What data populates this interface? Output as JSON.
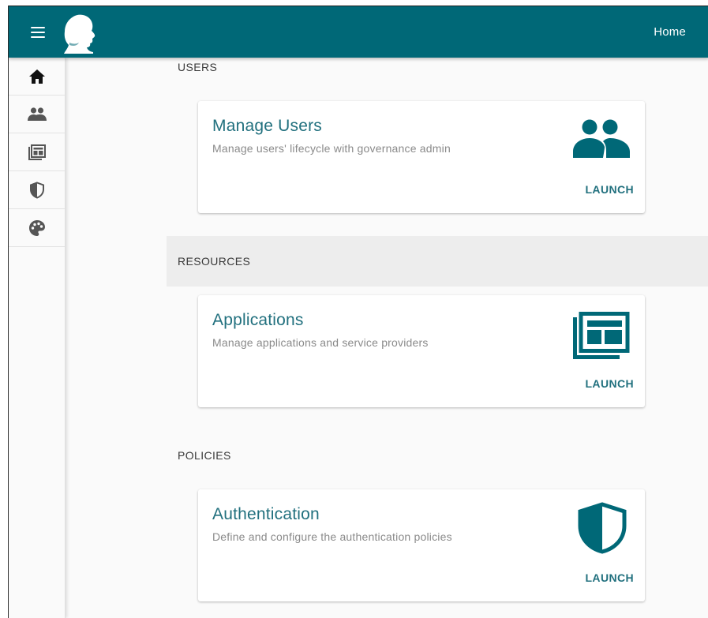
{
  "header": {
    "home_label": "Home",
    "brand_color": "#006877"
  },
  "sidebar": {
    "items": [
      {
        "icon": "home-icon",
        "active": true
      },
      {
        "icon": "users-icon"
      },
      {
        "icon": "applications-icon"
      },
      {
        "icon": "shield-icon"
      },
      {
        "icon": "palette-icon"
      }
    ]
  },
  "sections": [
    {
      "title": "USERS",
      "card": {
        "title": "Manage Users",
        "description": "Manage users' lifecycle with governance admin",
        "icon": "users-icon",
        "action": "LAUNCH"
      }
    },
    {
      "title": "RESOURCES",
      "card": {
        "title": "Applications",
        "description": "Manage applications and service providers",
        "icon": "applications-icon",
        "action": "LAUNCH"
      }
    },
    {
      "title": "POLICIES",
      "card": {
        "title": "Authentication",
        "description": "Define and configure the authentication policies",
        "icon": "shield-icon",
        "action": "LAUNCH"
      }
    }
  ],
  "colors": {
    "accent": "#21707e",
    "icon_teal": "#006877"
  }
}
